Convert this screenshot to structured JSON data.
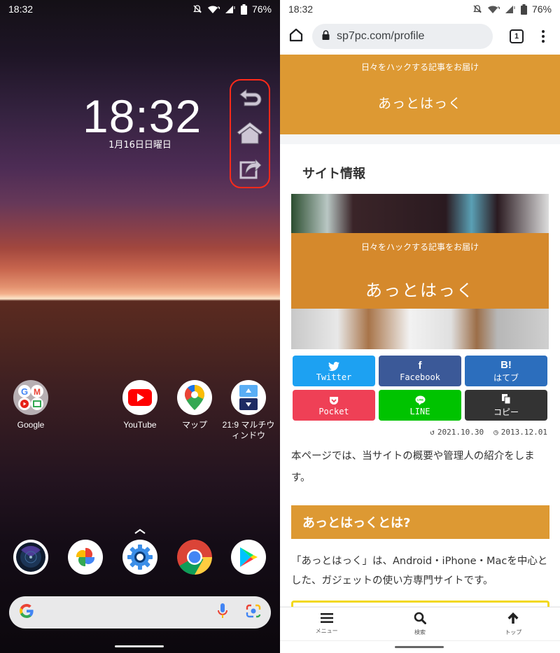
{
  "left_screen": {
    "status_bar": {
      "time": "18:32",
      "icons": [
        "bell-muted-icon",
        "wifi-icon",
        "signal-icon",
        "battery-icon"
      ],
      "battery": "76%"
    },
    "clock": {
      "time": "18:32",
      "date": "1月16日日曜日"
    },
    "floating_nav": {
      "buttons": [
        "back-icon",
        "home-icon",
        "share-icon"
      ],
      "highlight_color": "#ff2a1a"
    },
    "apps": [
      {
        "label": "Google",
        "icon": "google-folder-icon"
      },
      {
        "label": "YouTube",
        "icon": "youtube-icon"
      },
      {
        "label": "マップ",
        "icon": "maps-icon"
      },
      {
        "label": "21:9 マルチウィンドウ",
        "icon": "multi-window-icon"
      }
    ],
    "dock": [
      {
        "name": "camera",
        "icon": "camera-icon"
      },
      {
        "name": "photos",
        "icon": "photos-icon"
      },
      {
        "name": "settings",
        "icon": "settings-icon"
      },
      {
        "name": "chrome",
        "icon": "chrome-icon"
      },
      {
        "name": "play-store",
        "icon": "play-store-icon"
      }
    ],
    "search_bar": {
      "icons": [
        "google-g-icon",
        "mic-icon",
        "lens-icon"
      ]
    }
  },
  "right_screen": {
    "status_bar": {
      "time": "18:32",
      "battery": "76%"
    },
    "browser": {
      "url": "sp7pc.com/profile",
      "tab_count": "1"
    },
    "site_header": {
      "tagline": "日々をハックする記事をお届け",
      "site_name": "あっとはっく",
      "color": "#dd9933"
    },
    "page": {
      "title": "サイト情報",
      "hero": {
        "tagline": "日々をハックする記事をお届け",
        "site_name": "あっとはっく"
      },
      "share_buttons": [
        {
          "label": "Twitter",
          "glyph": "twitter-bird",
          "color": "#1da1f2"
        },
        {
          "label": "Facebook",
          "glyph": "f",
          "color": "#3b5998"
        },
        {
          "label": "はてブ",
          "glyph": "B!",
          "color": "#2c6ebd"
        },
        {
          "label": "Pocket",
          "glyph": "pocket",
          "color": "#ef4056"
        },
        {
          "label": "LINE",
          "glyph": "line",
          "color": "#00c300"
        },
        {
          "label": "コピー",
          "glyph": "copy",
          "color": "#333333"
        }
      ],
      "updated_date": "2021.10.30",
      "published_date": "2013.12.01",
      "intro": "本ページでは、当サイトの概要や管理人の紹介をします。",
      "section_heading": "あっとはっくとは?",
      "description": "「あっとはっく」は、Android・iPhone・Macを中心とした、ガジェットの使い方専門サイトです。"
    },
    "bottom_nav": [
      {
        "label": "メニュー",
        "icon": "menu-icon"
      },
      {
        "label": "検索",
        "icon": "search-icon"
      },
      {
        "label": "トップ",
        "icon": "arrow-up-icon"
      }
    ]
  }
}
